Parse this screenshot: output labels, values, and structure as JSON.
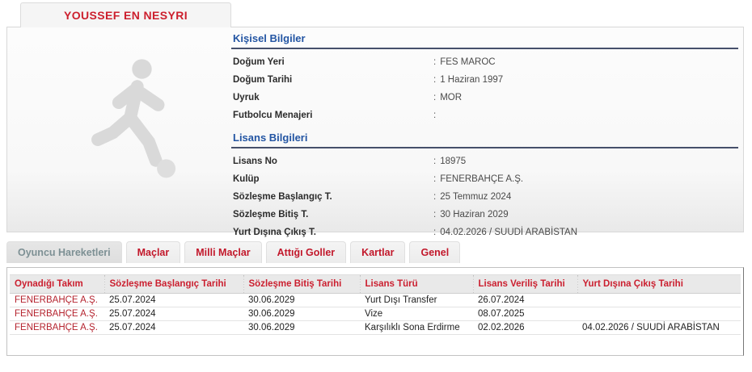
{
  "player": {
    "name": "YOUSSEF EN NESYRI"
  },
  "personal_info": {
    "title": "Kişisel Bilgiler",
    "rows": [
      {
        "label": "Doğum Yeri",
        "value": "FES MAROC"
      },
      {
        "label": "Doğum Tarihi",
        "value": "1 Haziran 1997"
      },
      {
        "label": "Uyruk",
        "value": "MOR"
      },
      {
        "label": "Futbolcu Menajeri",
        "value": ""
      }
    ]
  },
  "license_info": {
    "title": "Lisans Bilgileri",
    "rows": [
      {
        "label": "Lisans No",
        "value": "18975"
      },
      {
        "label": "Kulüp",
        "value": "FENERBAHÇE A.Ş."
      },
      {
        "label": "Sözleşme Başlangıç T.",
        "value": "25 Temmuz 2024"
      },
      {
        "label": "Sözleşme Bitiş T.",
        "value": "30 Haziran 2029"
      },
      {
        "label": "Yurt Dışına Çıkış T.",
        "value": "04.02.2026 / SUUDİ ARABİSTAN"
      }
    ]
  },
  "tabs": [
    {
      "label": "Oyuncu Hareketleri",
      "active": true
    },
    {
      "label": "Maçlar",
      "active": false
    },
    {
      "label": "Milli Maçlar",
      "active": false
    },
    {
      "label": "Attığı Goller",
      "active": false
    },
    {
      "label": "Kartlar",
      "active": false
    },
    {
      "label": "Genel",
      "active": false
    }
  ],
  "movements_table": {
    "columns": [
      "Oynadığı Takım",
      "Sözleşme Başlangıç Tarihi",
      "Sözleşme Bitiş Tarihi",
      "Lisans Türü",
      "Lisans Veriliş Tarihi",
      "Yurt Dışına Çıkış Tarihi"
    ],
    "rows": [
      [
        "FENERBAHÇE A.Ş.",
        "25.07.2024",
        "30.06.2029",
        "Yurt Dışı Transfer",
        "26.07.2024",
        ""
      ],
      [
        "FENERBAHÇE A.Ş.",
        "25.07.2024",
        "30.06.2029",
        "Vize",
        "08.07.2025",
        ""
      ],
      [
        "FENERBAHÇE A.Ş.",
        "25.07.2024",
        "30.06.2029",
        "Karşılıklı Sona Erdirme",
        "02.02.2026",
        "04.02.2026 / SUUDİ ARABİSTAN"
      ]
    ]
  },
  "colors": {
    "accent_red": "#cc1f2d",
    "heading_blue": "#2355a3",
    "heading_underline": "#46506b",
    "active_tab_text": "#7d9094",
    "table_header_bg": "#e9e9e9",
    "silhouette_gray": "#d9d9d9"
  }
}
